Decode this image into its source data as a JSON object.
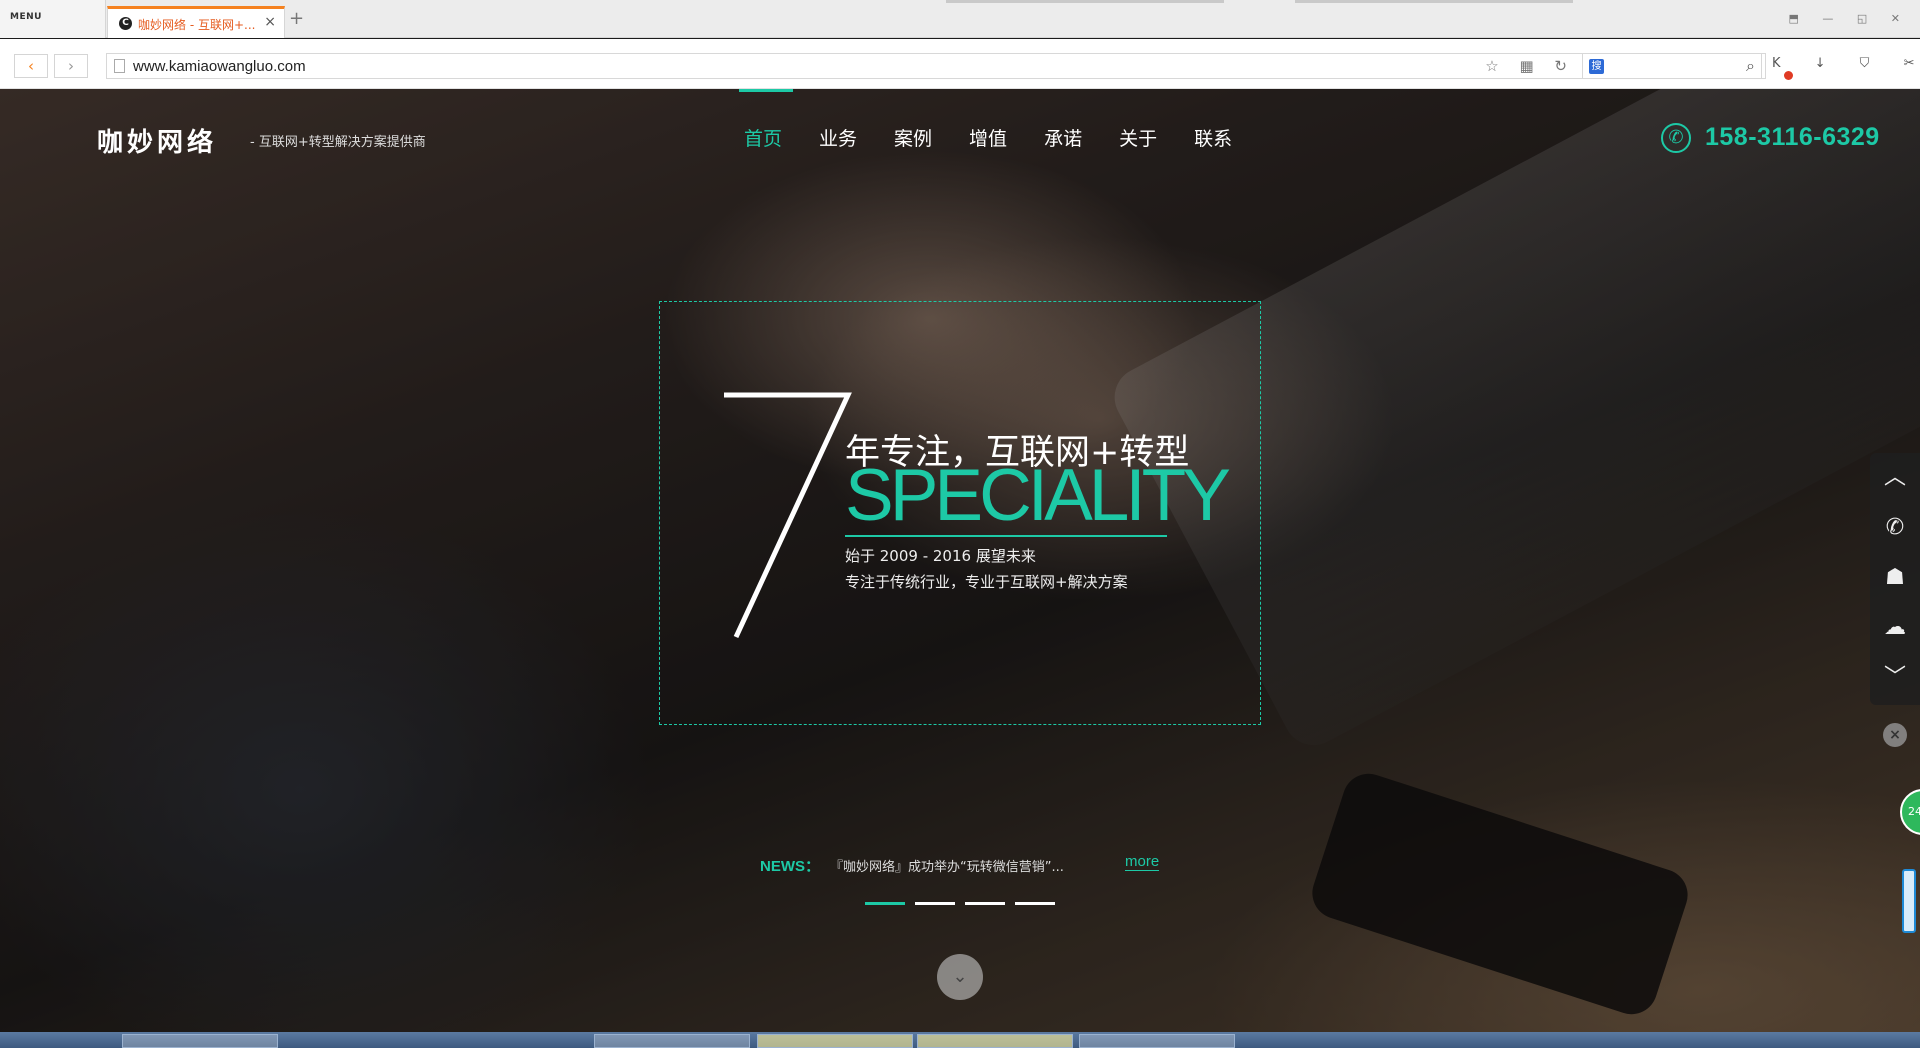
{
  "browser": {
    "menu_label": "MENU",
    "tab": {
      "title": "咖妙网络 - 互联网+...",
      "close_glyph": "×"
    },
    "new_tab_glyph": "+",
    "url": "www.kamiaowangluo.com",
    "back_glyph": "‹",
    "forward_glyph": "›",
    "window_controls": "⬒ — ◱ ✕",
    "url_tools": "☆ ▦ ↻",
    "search_engine_glyph": "搜",
    "search_glyph": "⌕",
    "extensions": "K ↓ ⛉ ✂ ⋯"
  },
  "site": {
    "logo": "咖妙网络",
    "tagline": "- 互联网+转型解决方案提供商",
    "nav": [
      {
        "label": "首页",
        "active": true
      },
      {
        "label": "业务",
        "active": false
      },
      {
        "label": "案例",
        "active": false
      },
      {
        "label": "增值",
        "active": false
      },
      {
        "label": "承诺",
        "active": false
      },
      {
        "label": "关于",
        "active": false
      },
      {
        "label": "联系",
        "active": false
      }
    ],
    "phone_glyph": "✆",
    "phone": "158-3116-6329",
    "accent_color": "#1dc9a6"
  },
  "hero": {
    "big_number": "7",
    "line1": "年专注，互联网+转型",
    "english": "SPECIALITY",
    "line2": "始于 2009 - 2016 展望未来",
    "line3": "专注于传统行业，专业于互联网+解决方案",
    "news_label": "NEWS：",
    "news_text": "『咖妙网络』成功举办“玩转微信营销”...",
    "news_more": "more",
    "slides": 4,
    "active_slide": 1,
    "scroll_glyph": "⌄"
  },
  "side_tools": {
    "items": [
      {
        "name": "scroll-up",
        "glyph": "︿"
      },
      {
        "name": "phone",
        "glyph": "✆"
      },
      {
        "name": "qq",
        "glyph": "☗"
      },
      {
        "name": "wechat",
        "glyph": "☁"
      },
      {
        "name": "scroll-down",
        "glyph": "﹀"
      }
    ],
    "close_glyph": "×",
    "online_badge": "24"
  }
}
